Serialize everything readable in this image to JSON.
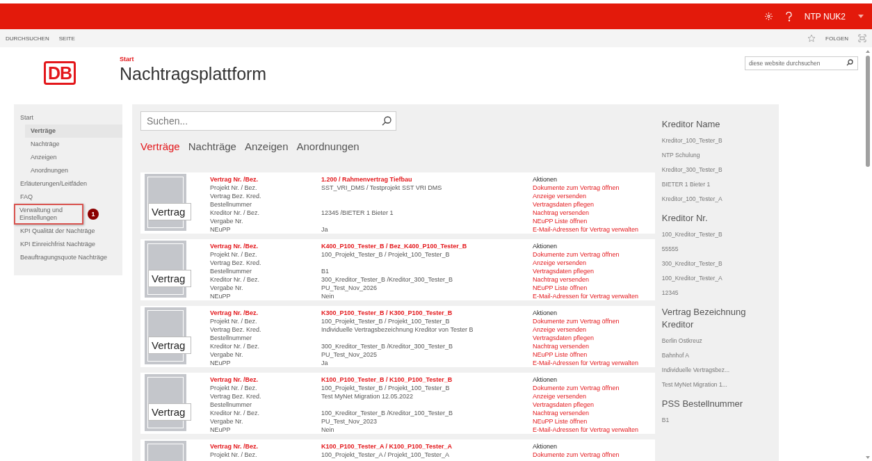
{
  "top_bar": {
    "user": "NTP NUK2"
  },
  "ribbon": {
    "tabs": [
      "DURCHSUCHEN",
      "SEITE"
    ],
    "follow": "FOLGEN"
  },
  "header": {
    "logo": "DB",
    "breadcrumb": "Start",
    "title": "Nachtragsplattform",
    "site_search": {
      "placeholder": "diese website durchsuchen"
    }
  },
  "sidebar": {
    "items": [
      {
        "label": "Start",
        "selected": false,
        "highlighted": false,
        "children": [
          {
            "label": "Verträge",
            "selected": true,
            "highlighted": false
          },
          {
            "label": "Nachträge",
            "selected": false,
            "highlighted": false
          },
          {
            "label": "Anzeigen",
            "selected": false,
            "highlighted": false
          },
          {
            "label": "Anordnungen",
            "selected": false,
            "highlighted": false
          }
        ]
      },
      {
        "label": "Erläuterungen/Leitfäden",
        "selected": false,
        "highlighted": false
      },
      {
        "label": "FAQ",
        "selected": false,
        "highlighted": false
      },
      {
        "label": "Verwaltung und Einstellungen",
        "selected": false,
        "highlighted": true,
        "badge": "1"
      },
      {
        "label": "KPI Qualität der Nachträge",
        "selected": false,
        "highlighted": false
      },
      {
        "label": "KPI Einreichfrist Nachträge",
        "selected": false,
        "highlighted": false
      },
      {
        "label": "Beauftragungsquote Nachträge",
        "selected": false,
        "highlighted": false
      }
    ]
  },
  "search": {
    "placeholder": "Suchen..."
  },
  "tabs": [
    {
      "label": "Verträge",
      "selected": true
    },
    {
      "label": "Nachträge",
      "selected": false
    },
    {
      "label": "Anzeigen",
      "selected": false
    },
    {
      "label": "Anordnungen",
      "selected": false
    }
  ],
  "contracts": [
    {
      "thumb": "Vertrag",
      "rows": [
        [
          "Vertrag Nr. /Bez.",
          "1.200 / Rahmenvertrag Tiefbau"
        ],
        [
          "Projekt Nr. / Bez.",
          "SST_VRI_DMS / Testprojekt SST VRI DMS"
        ],
        [
          "Vertrag Bez. Kred.",
          ""
        ],
        [
          "Bestellnummer",
          ""
        ],
        [
          "Kreditor Nr. / Bez.",
          "12345 /BIETER 1 Bieter 1"
        ],
        [
          "Vergabe Nr.",
          ""
        ],
        [
          "NEuPP",
          "Ja"
        ]
      ],
      "actions_title": "Aktionen",
      "actions": [
        "Dokumente zum Vertrag öffnen",
        "Anzeige versenden",
        "Vertragsdaten pflegen",
        "Nachtrag versenden",
        "NEuPP Liste öffnen",
        "E-Mail-Adressen für Vertrag verwalten"
      ]
    },
    {
      "thumb": "Vertrag",
      "rows": [
        [
          "Vertrag Nr. /Bez.",
          "K400_P100_Tester_B / Bez_K400_P100_Tester_B"
        ],
        [
          "Projekt Nr. / Bez.",
          "100_Projekt_Tester_B / Projekt_100_Tester_B"
        ],
        [
          "Vertrag Bez. Kred.",
          ""
        ],
        [
          "Bestellnummer",
          "B1"
        ],
        [
          "Kreditor Nr. / Bez.",
          "300_Kreditor_Tester_B /Kreditor_300_Tester_B"
        ],
        [
          "Vergabe Nr.",
          "PU_Test_Nov_2026"
        ],
        [
          "NEuPP",
          "Nein"
        ]
      ],
      "actions_title": "Aktionen",
      "actions": [
        "Dokumente zum Vertrag öffnen",
        "Anzeige versenden",
        "Vertragsdaten pflegen",
        "Nachtrag versenden",
        "NEuPP Liste öffnen",
        "E-Mail-Adressen für Vertrag verwalten"
      ]
    },
    {
      "thumb": "Vertrag",
      "rows": [
        [
          "Vertrag Nr. /Bez.",
          "K300_P100_Tester_B / K300_P100_Tester_B"
        ],
        [
          "Projekt Nr. / Bez.",
          "100_Projekt_Tester_B / Projekt_100_Tester_B"
        ],
        [
          "Vertrag Bez. Kred.",
          "Individuelle Vertragsbezeichnung Kreditor von Tester B"
        ],
        [
          "Bestellnummer",
          ""
        ],
        [
          "Kreditor Nr. / Bez.",
          "300_Kreditor_Tester_B /Kreditor_300_Tester_B"
        ],
        [
          "Vergabe Nr.",
          "PU_Test_Nov_2025"
        ],
        [
          "NEuPP",
          "Ja"
        ]
      ],
      "actions_title": "Aktionen",
      "actions": [
        "Dokumente zum Vertrag öffnen",
        "Anzeige versenden",
        "Vertragsdaten pflegen",
        "Nachtrag versenden",
        "NEuPP Liste öffnen",
        "E-Mail-Adressen für Vertrag verwalten"
      ]
    },
    {
      "thumb": "Vertrag",
      "rows": [
        [
          "Vertrag Nr. /Bez.",
          "K100_P100_Tester_B / K100_P100_Tester_B"
        ],
        [
          "Projekt Nr. / Bez.",
          "100_Projekt_Tester_B / Projekt_100_Tester_B"
        ],
        [
          "Vertrag Bez. Kred.",
          "Test MyNet Migration 12.05.2022"
        ],
        [
          "Bestellnummer",
          ""
        ],
        [
          "Kreditor Nr. / Bez.",
          "100_Kreditor_Tester_B /Kreditor_100_Tester_B"
        ],
        [
          "Vergabe Nr.",
          "PU_Test_Nov_2023"
        ],
        [
          "NEuPP",
          "Nein"
        ]
      ],
      "actions_title": "Aktionen",
      "actions": [
        "Dokumente zum Vertrag öffnen",
        "Anzeige versenden",
        "Vertragsdaten pflegen",
        "Nachtrag versenden",
        "NEuPP Liste öffnen",
        "E-Mail-Adressen für Vertrag verwalten"
      ]
    },
    {
      "rows": [
        [
          "Vertrag Nr. /Bez.",
          "K100_P100_Tester_A / K100_P100_Tester_A"
        ],
        [
          "Projekt Nr. / Bez.",
          "100_Projekt_Tester_A / Projekt_100_Tester_A"
        ]
      ],
      "actions_title": "Aktionen",
      "actions": [
        "Dokumente zum Vertrag öffnen"
      ]
    }
  ],
  "filters": [
    {
      "title": "Kreditor Name",
      "items": [
        "Kreditor_100_Tester_B",
        "NTP Schulung",
        "Kreditor_300_Tester_B",
        "BIETER 1 Bieter 1",
        "Kreditor_100_Tester_A"
      ]
    },
    {
      "title": "Kreditor Nr.",
      "items": [
        "100_Kreditor_Tester_B",
        "55555",
        "300_Kreditor_Tester_B",
        "100_Kreditor_Tester_A",
        "12345"
      ]
    },
    {
      "title": "Vertrag Bezeichnung Kreditor",
      "items": [
        "Berlin Ostkreuz",
        "Bahnhof A",
        "Individuelle Vertragsbez...",
        "Test MyNet Migration 1..."
      ]
    },
    {
      "title": "PSS Bestellnummer",
      "items": [
        "B1"
      ]
    }
  ]
}
